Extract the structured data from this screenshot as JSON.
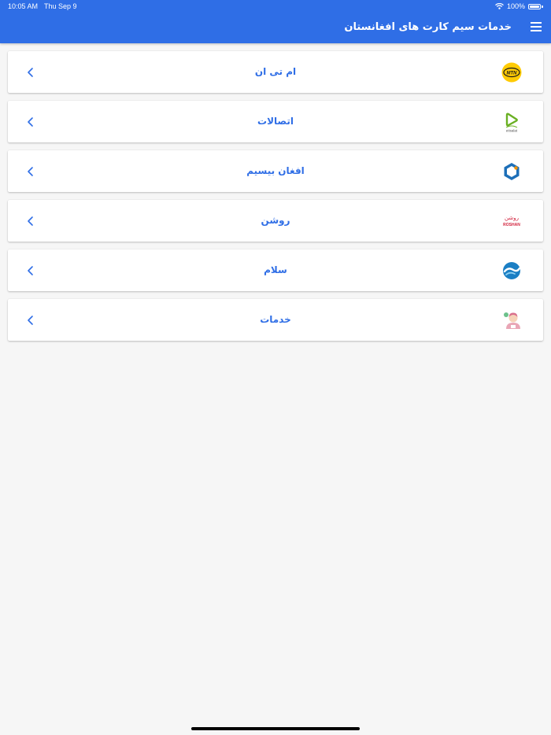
{
  "status_bar": {
    "time": "10:05 AM",
    "date": "Thu Sep 9",
    "battery": "100%"
  },
  "header": {
    "title": "خدمات سیم کارت های افغانستان"
  },
  "items": [
    {
      "label": "ام تی ان",
      "icon": "mtn-logo-icon"
    },
    {
      "label": "اتصالات",
      "icon": "etisalat-logo-icon",
      "logo_text": "etisalat"
    },
    {
      "label": "افغان بیسیم",
      "icon": "awcc-logo-icon"
    },
    {
      "label": "روشن",
      "icon": "roshan-logo-icon",
      "logo_text": "روشن",
      "logo_text_2": "ROSHAN"
    },
    {
      "label": "سلام",
      "icon": "salaam-logo-icon"
    },
    {
      "label": "خدمات",
      "icon": "support-agent-icon"
    }
  ],
  "colors": {
    "primary": "#2f6ee6",
    "background": "#f6f6f6",
    "card": "#ffffff"
  }
}
